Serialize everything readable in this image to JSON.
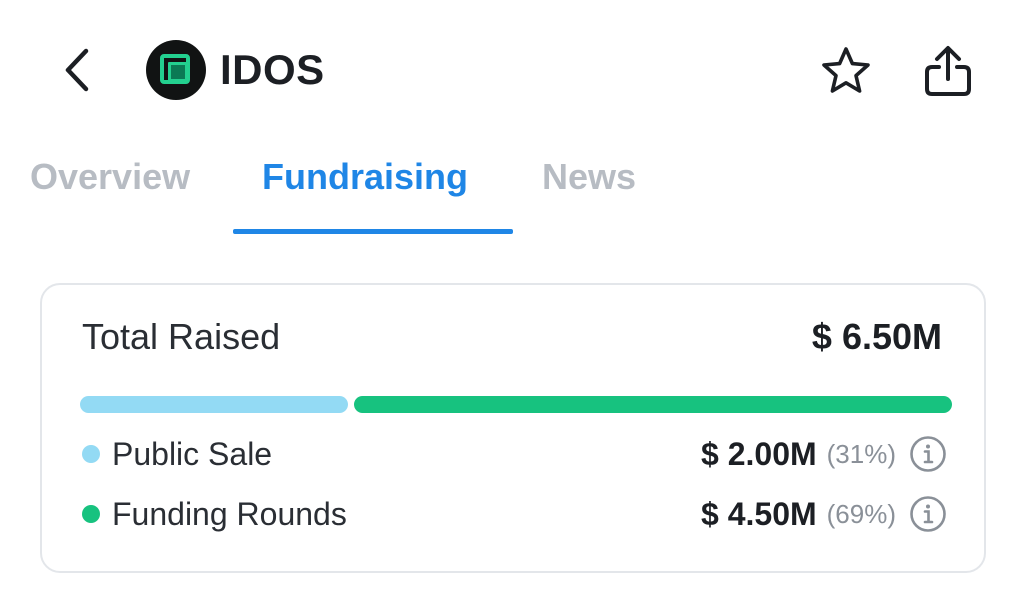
{
  "header": {
    "title": "IDOS",
    "icons": {
      "back": "chevron-left-icon",
      "logo": "idos-logo-icon",
      "favorite": "star-icon",
      "share": "share-icon"
    }
  },
  "tabs": [
    {
      "label": "Overview",
      "active": false
    },
    {
      "label": "Fundraising",
      "active": true
    },
    {
      "label": "News",
      "active": false
    }
  ],
  "summary": {
    "total_label": "Total Raised",
    "total_value": "$ 6.50M",
    "colors": {
      "public_sale": "#93daf4",
      "funding_rounds": "#17c27f",
      "accent": "#1f86e6",
      "logo": "#23d08f"
    },
    "breakdown": [
      {
        "label": "Public Sale",
        "amount": "$ 2.00M",
        "percent": "(31%)",
        "share": 0.31
      },
      {
        "label": "Funding Rounds",
        "amount": "$ 4.50M",
        "percent": "(69%)",
        "share": 0.69
      }
    ]
  }
}
